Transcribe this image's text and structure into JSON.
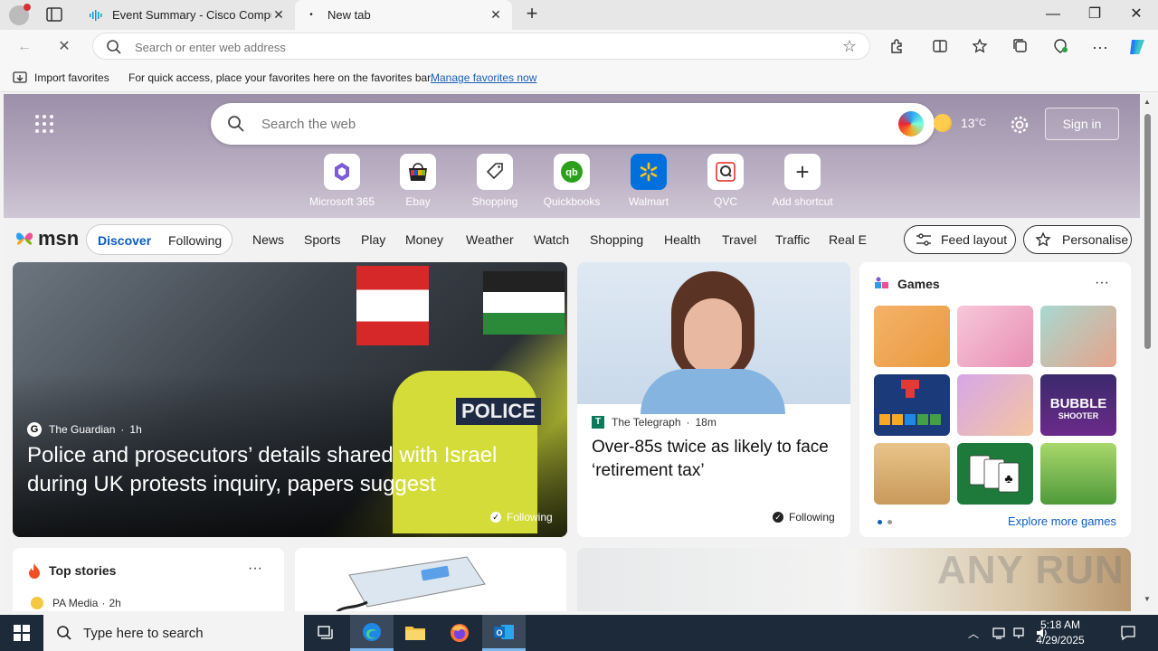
{
  "browser": {
    "tabs": [
      {
        "title": "Event Summary - Cisco Compute",
        "active": false
      },
      {
        "title": "New tab",
        "active": true
      }
    ],
    "address_placeholder": "Search or enter web address",
    "favorites_bar": {
      "import_label": "Import favorites",
      "message": "For quick access, place your favorites here on the favorites bar.",
      "manage_link": "Manage favorites now"
    }
  },
  "newtab": {
    "search_placeholder": "Search the web",
    "temperature": "13",
    "temperature_unit": "°C",
    "sign_in": "Sign in",
    "shortcuts": [
      {
        "label": "Microsoft 365",
        "icon": "microsoft365-icon"
      },
      {
        "label": "Ebay",
        "icon": "ebay-icon"
      },
      {
        "label": "Shopping",
        "icon": "shopping-tag-icon"
      },
      {
        "label": "Quickbooks",
        "icon": "quickbooks-icon"
      },
      {
        "label": "Walmart",
        "icon": "walmart-icon"
      },
      {
        "label": "QVC",
        "icon": "qvc-icon"
      },
      {
        "label": "Add shortcut",
        "icon": "plus-icon"
      }
    ]
  },
  "msn": {
    "logo": "msn",
    "segments": [
      "Discover",
      "Following"
    ],
    "nav": [
      "News",
      "Sports",
      "Play",
      "Money",
      "Weather",
      "Watch",
      "Shopping",
      "Health",
      "Travel",
      "Traffic",
      "Real E"
    ],
    "feed_layout": "Feed layout",
    "personalise": "Personalise"
  },
  "cards": {
    "main": {
      "source": "The Guardian",
      "age": "1h",
      "headline": "Police and prosecutors’ details shared with Israel during UK protests inquiry, papers suggest",
      "following": "Following",
      "sign_text": "POLICE"
    },
    "telegraph": {
      "source": "The Telegraph",
      "age": "18m",
      "headline": "Over-85s twice as likely to face ‘retirement tax’",
      "following": "Following"
    },
    "games": {
      "title": "Games",
      "explore": "Explore more games",
      "bubble_title": "BUBBLE",
      "bubble_sub": "SHOOTER"
    },
    "top_stories": {
      "title": "Top stories",
      "source": "PA Media",
      "age": "2h"
    }
  },
  "watermark": "ANY RUN",
  "taskbar": {
    "search_placeholder": "Type here to search",
    "time": "5:18 AM",
    "date": "4/29/2025"
  },
  "colors": {
    "accent": "#0a5cc2",
    "hero_top": "#9c8fa9",
    "taskbar": "#1c2a3a"
  }
}
